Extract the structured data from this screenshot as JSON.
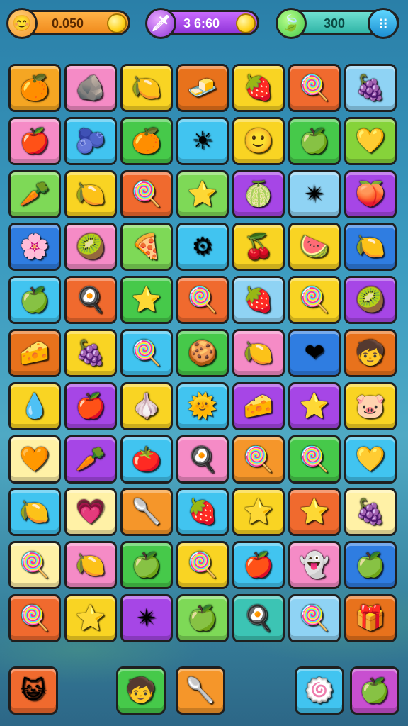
{
  "hud": {
    "coins": {
      "value": "0.050",
      "icon": "face-icon",
      "color": "#f5962a"
    },
    "gems": {
      "value": "3 6:60",
      "icon": "sword-icon",
      "color": "#a646e6"
    },
    "energy": {
      "value": "300",
      "icon": "leaf-icon",
      "color": "#3cc4b4"
    },
    "menu_icon": "menu-icon"
  },
  "grid": {
    "rows": [
      [
        {
          "bg": "#f5a623",
          "g": "🍊",
          "icon": "orange-icon"
        },
        {
          "bg": "#f58bc6",
          "g": "🪨",
          "icon": "rock-face-icon"
        },
        {
          "bg": "#f9d423",
          "g": "🍋",
          "icon": "lemon-icon"
        },
        {
          "bg": "#e8721c",
          "g": "🧈",
          "icon": "butter-icon"
        },
        {
          "bg": "#f9d423",
          "g": "🍓",
          "icon": "strawberry-icon"
        },
        {
          "bg": "#f06a2e",
          "g": "🍭",
          "icon": "lollipop-icon"
        },
        {
          "bg": "#8fd3f4",
          "g": "🍇",
          "icon": "plum-icon"
        }
      ],
      [
        {
          "bg": "#f58bc6",
          "g": "🍎",
          "icon": "red-fruit-icon"
        },
        {
          "bg": "#41c4f0",
          "g": "🫐",
          "icon": "blue-apple-icon"
        },
        {
          "bg": "#46c94a",
          "g": "🍊",
          "icon": "orange-pop-icon"
        },
        {
          "bg": "#41c4f0",
          "g": "☀",
          "icon": "sun-icon"
        },
        {
          "bg": "#f9d423",
          "g": "🙂",
          "icon": "smiley-icon"
        },
        {
          "bg": "#46c94a",
          "g": "🍏",
          "icon": "green-blob-icon"
        },
        {
          "bg": "#86d33a",
          "g": "💛",
          "icon": "heart-icon"
        }
      ],
      [
        {
          "bg": "#7ed957",
          "g": "🥕",
          "icon": "carrot-icon"
        },
        {
          "bg": "#f9d423",
          "g": "🍋",
          "icon": "lemon-icon"
        },
        {
          "bg": "#f06a2e",
          "g": "🍭",
          "icon": "lollipop-icon"
        },
        {
          "bg": "#7ed957",
          "g": "⭐",
          "icon": "star-icon"
        },
        {
          "bg": "#a646e6",
          "g": "🍈",
          "icon": "melon-slice-icon"
        },
        {
          "bg": "#8fd3f4",
          "g": "✴",
          "icon": "starburst-icon"
        },
        {
          "bg": "#a646e6",
          "g": "🍑",
          "icon": "peach-icon"
        }
      ],
      [
        {
          "bg": "#2f7de1",
          "g": "🌸",
          "icon": "flower-icon"
        },
        {
          "bg": "#f58bc6",
          "g": "🥝",
          "icon": "kiwi-icon"
        },
        {
          "bg": "#7ed957",
          "g": "🍕",
          "icon": "pizza-icon"
        },
        {
          "bg": "#41c4f0",
          "g": "⚙",
          "icon": "gear-icon"
        },
        {
          "bg": "#f9d423",
          "g": "🍒",
          "icon": "cherry-icon"
        },
        {
          "bg": "#f9d423",
          "g": "🍉",
          "icon": "watermelon-icon"
        },
        {
          "bg": "#2f7de1",
          "g": "🍋",
          "icon": "lemon-icon"
        }
      ],
      [
        {
          "bg": "#41c4f0",
          "g": "🍏",
          "icon": "green-blob-icon"
        },
        {
          "bg": "#f06a2e",
          "g": "🍳",
          "icon": "pan-icon"
        },
        {
          "bg": "#46c94a",
          "g": "⭐",
          "icon": "star-icon"
        },
        {
          "bg": "#f06a2e",
          "g": "🍭",
          "icon": "lollipop-icon"
        },
        {
          "bg": "#8fd3f4",
          "g": "🍓",
          "icon": "strawberry-icon"
        },
        {
          "bg": "#f9d423",
          "g": "🍭",
          "icon": "lollipop-icon"
        },
        {
          "bg": "#a646e6",
          "g": "🥝",
          "icon": "kiwi-icon"
        }
      ],
      [
        {
          "bg": "#e8721c",
          "g": "🧀",
          "icon": "cheese-icon"
        },
        {
          "bg": "#f9d423",
          "g": "🍇",
          "icon": "grape-icon"
        },
        {
          "bg": "#41c4f0",
          "g": "🍭",
          "icon": "lollipop-icon"
        },
        {
          "bg": "#46c94a",
          "g": "🍪",
          "icon": "cookie-icon"
        },
        {
          "bg": "#f58bc6",
          "g": "🍋",
          "icon": "lemon-icon"
        },
        {
          "bg": "#2f7de1",
          "g": "❤",
          "icon": "heart-icon"
        },
        {
          "bg": "#e8721c",
          "g": "🧒",
          "icon": "kid-icon"
        }
      ],
      [
        {
          "bg": "#f9d423",
          "g": "💧",
          "icon": "drop-icon"
        },
        {
          "bg": "#a646e6",
          "g": "🍎",
          "icon": "apple-icon"
        },
        {
          "bg": "#f9d423",
          "g": "🧄",
          "icon": "garlic-icon"
        },
        {
          "bg": "#41c4f0",
          "g": "🌞",
          "icon": "sunface-icon"
        },
        {
          "bg": "#a646e6",
          "g": "🧀",
          "icon": "cheese-icon"
        },
        {
          "bg": "#a646e6",
          "g": "⭐",
          "icon": "star-icon"
        },
        {
          "bg": "#f9d423",
          "g": "🐷",
          "icon": "pig-icon"
        }
      ],
      [
        {
          "bg": "#fff1a6",
          "g": "🧡",
          "icon": "heart-icon"
        },
        {
          "bg": "#a646e6",
          "g": "🥕",
          "icon": "carrot-icon"
        },
        {
          "bg": "#41c4f0",
          "g": "🍅",
          "icon": "tomato-icon"
        },
        {
          "bg": "#f58bc6",
          "g": "🍳",
          "icon": "pan-icon"
        },
        {
          "bg": "#f5962a",
          "g": "🍭",
          "icon": "lollipop-icon"
        },
        {
          "bg": "#46c94a",
          "g": "🍭",
          "icon": "lollipop-icon"
        },
        {
          "bg": "#41c4f0",
          "g": "💛",
          "icon": "heart-icon"
        }
      ],
      [
        {
          "bg": "#41c4f0",
          "g": "🍋",
          "icon": "lemon-icon"
        },
        {
          "bg": "#fff1a6",
          "g": "💗",
          "icon": "heart-icon"
        },
        {
          "bg": "#f5962a",
          "g": "🥄",
          "icon": "spoon-icon"
        },
        {
          "bg": "#41c4f0",
          "g": "🍓",
          "icon": "strawberry-icon"
        },
        {
          "bg": "#f9d423",
          "g": "⭐",
          "icon": "star-icon"
        },
        {
          "bg": "#f06a2e",
          "g": "⭐",
          "icon": "star-icon"
        },
        {
          "bg": "#fff1a6",
          "g": "🍇",
          "icon": "plum-icon"
        }
      ],
      [
        {
          "bg": "#fff1a6",
          "g": "🍭",
          "icon": "lollipop-icon"
        },
        {
          "bg": "#f58bc6",
          "g": "🍋",
          "icon": "lemon-icon"
        },
        {
          "bg": "#46c94a",
          "g": "🍏",
          "icon": "green-blob-icon"
        },
        {
          "bg": "#f9d423",
          "g": "🍭",
          "icon": "lollipop-icon"
        },
        {
          "bg": "#41c4f0",
          "g": "🍎",
          "icon": "apple-icon"
        },
        {
          "bg": "#f58bc6",
          "g": "👻",
          "icon": "ghost-icon"
        },
        {
          "bg": "#2f7de1",
          "g": "🍏",
          "icon": "green-blob-icon"
        }
      ],
      [
        {
          "bg": "#f06a2e",
          "g": "🍭",
          "icon": "lollipop-icon"
        },
        {
          "bg": "#f9d423",
          "g": "⭐",
          "icon": "star-icon"
        },
        {
          "bg": "#a646e6",
          "g": "✴",
          "icon": "starburst-icon"
        },
        {
          "bg": "#7ed957",
          "g": "🍏",
          "icon": "green-blob-icon"
        },
        {
          "bg": "#3cc4b4",
          "g": "🍳",
          "icon": "pan-icon"
        },
        {
          "bg": "#8fd3f4",
          "g": "🍭",
          "icon": "lollipop-icon"
        },
        {
          "bg": "#e8721c",
          "g": "🎁",
          "icon": "chest-icon"
        }
      ]
    ]
  },
  "bottom_bar": [
    {
      "bg": "#f06a2e",
      "g": "😺",
      "icon": "cat-face-icon"
    },
    {
      "bg": "#46c94a",
      "g": "🧒",
      "icon": "kid-icon"
    },
    {
      "bg": "#f5962a",
      "g": "🥄",
      "icon": "spoon-icon"
    },
    {
      "bg": "#41c4f0",
      "g": "🍥",
      "icon": "swirl-icon"
    },
    {
      "bg": "#c84fd0",
      "g": "🍏",
      "icon": "green-blob-icon"
    }
  ]
}
